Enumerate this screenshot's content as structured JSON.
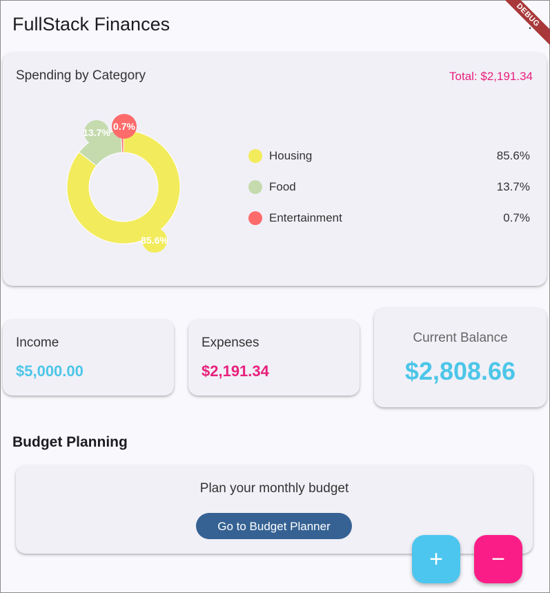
{
  "app": {
    "title": "FullStack Finances",
    "overflow_icon": "vertical-dots-icon",
    "debug_banner": "DEBUG"
  },
  "spending": {
    "title": "Spending by Category",
    "total": "Total: $2,191.34",
    "categories": [
      {
        "name": "Housing",
        "percent": "85.6%",
        "value": 85.6,
        "color": "#f2eb5c"
      },
      {
        "name": "Food",
        "percent": "13.7%",
        "value": 13.7,
        "color": "#c5dbae"
      },
      {
        "name": "Entertainment",
        "percent": "0.7%",
        "value": 0.7,
        "color": "#fe6b6b"
      }
    ]
  },
  "stats": {
    "income_label": "Income",
    "income_value": "$5,000.00",
    "income_color": "#4cc6e8",
    "expenses_label": "Expenses",
    "expenses_value": "$2,191.34",
    "expenses_color": "#e8207c",
    "balance_label": "Current Balance",
    "balance_value": "$2,808.66",
    "balance_color": "#4cc6e8"
  },
  "budget": {
    "section_title": "Budget Planning",
    "text": "Plan your monthly budget",
    "button_label": "Go to Budget Planner"
  },
  "fabs": {
    "add_label": "+",
    "subtract_label": "−",
    "add_color": "#4cc6ef",
    "subtract_color": "#fb1d87"
  }
}
